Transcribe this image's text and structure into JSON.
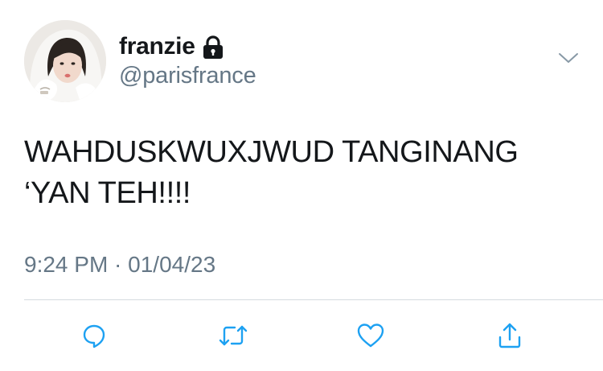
{
  "tweet": {
    "display_name": "franzie",
    "handle": "@parisfrance",
    "text": "WAHDUSKWUXJWUD TANGINANG\n‘YAN TEH!!!!",
    "timestamp": "9:24 PM · 01/04/23"
  },
  "icons": {
    "lock": "lock-icon",
    "menu": "chevron-down-icon",
    "reply": "reply-icon",
    "retweet": "retweet-icon",
    "like": "heart-icon",
    "share": "share-icon"
  },
  "colors": {
    "text": "#14171a",
    "secondary": "#657786",
    "icon": "#1da1f2",
    "divider": "#d6dbdf"
  }
}
